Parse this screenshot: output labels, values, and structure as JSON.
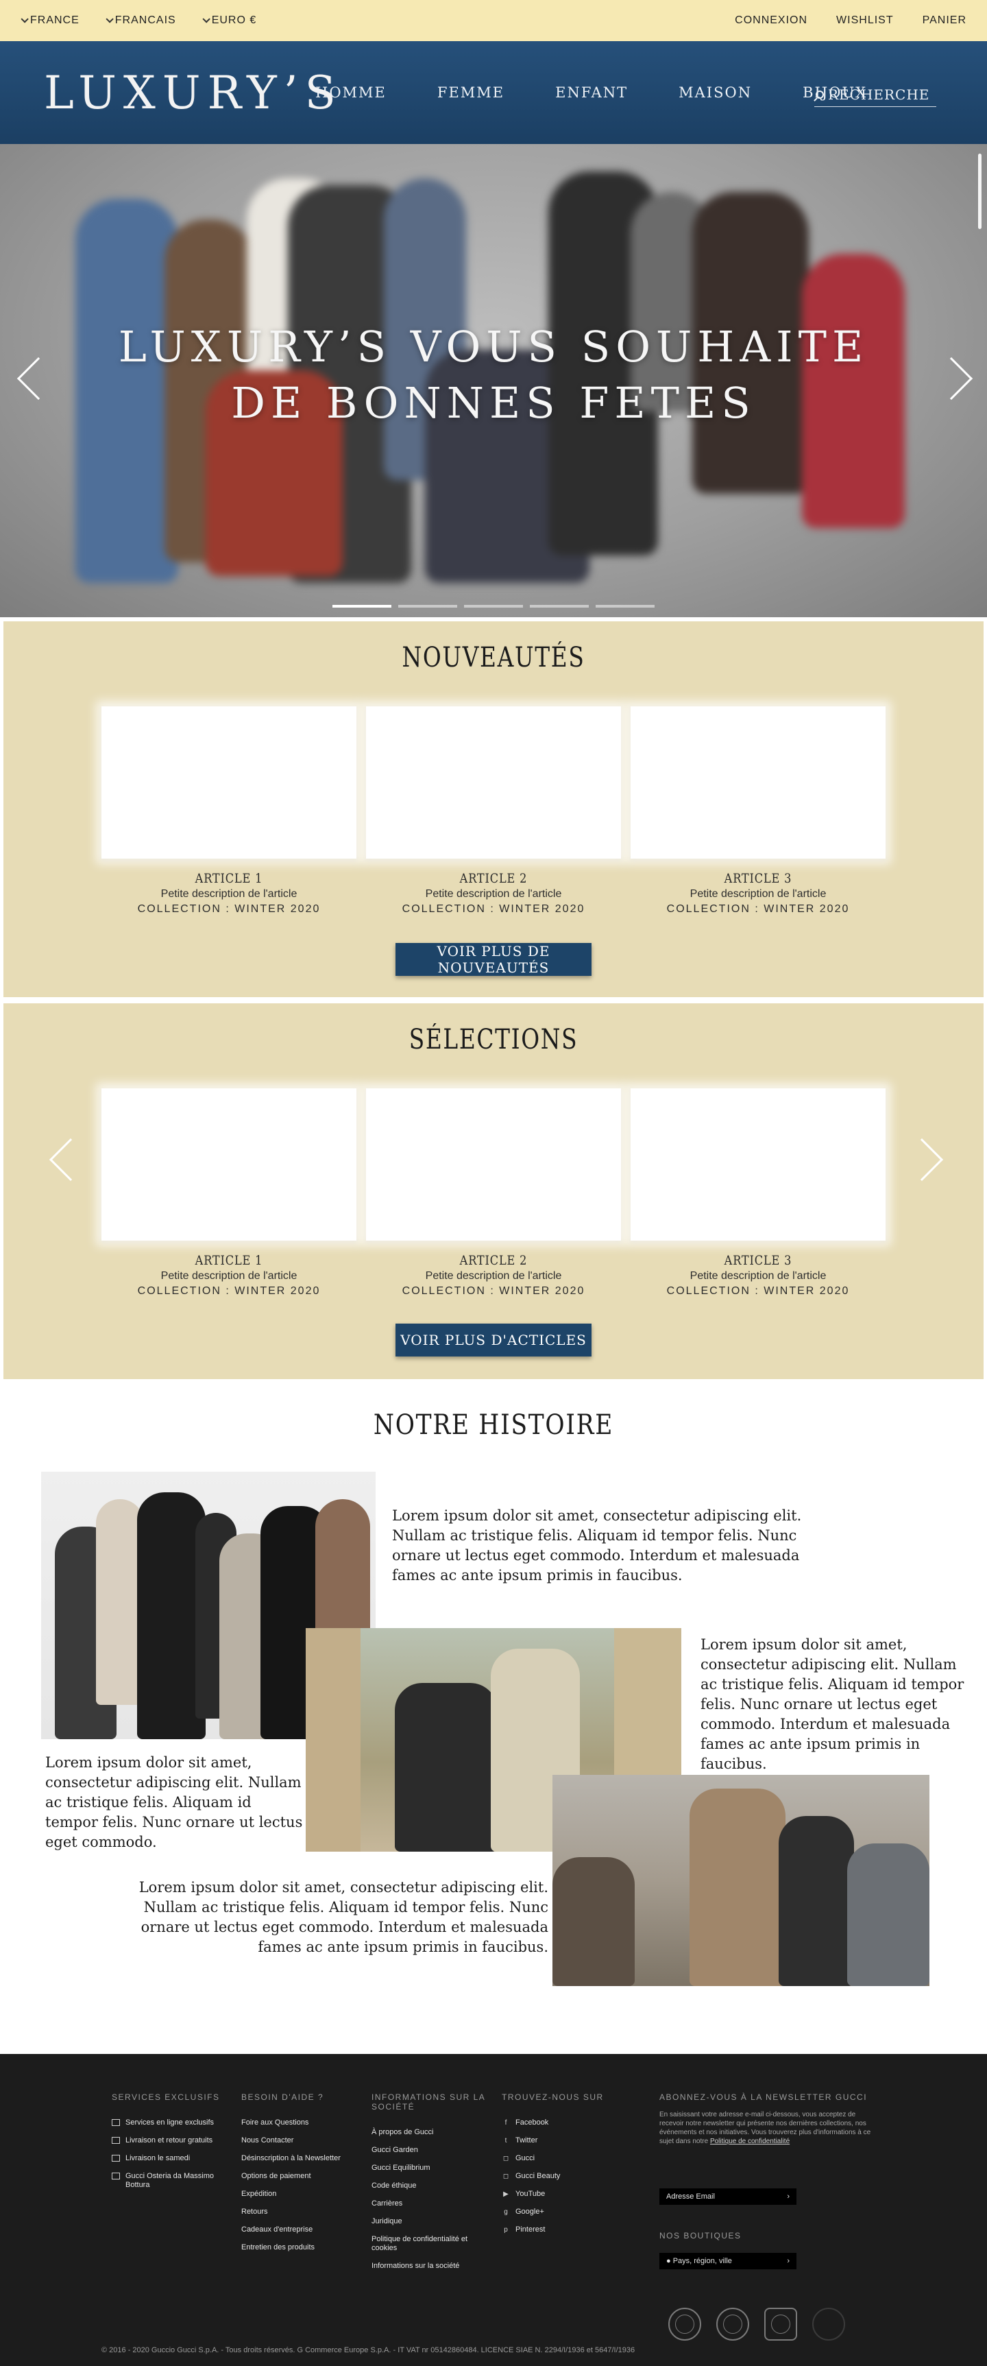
{
  "topbar": {
    "country": "FRANCE",
    "language": "FRANCAIS",
    "currency": "EURO €",
    "links": [
      "CONNEXION",
      "WISHLIST",
      "PANIER"
    ]
  },
  "header": {
    "logo": "LUXURY’S",
    "nav": [
      "HOMME",
      "FEMME",
      "ENFANT",
      "MAISON",
      "BIJOUX"
    ],
    "search_label": "RECHERCHE"
  },
  "hero": {
    "title_line1": "LUXURY’S VOUS SOUHAITE",
    "title_line2": "DE BONNES FETES",
    "slides": 5,
    "active_slide": 1
  },
  "nouveautes": {
    "title": "NOUVEAUTÉS",
    "items": [
      {
        "name": "ARTICLE 1",
        "desc": "Petite description de l'article",
        "collection": "COLLECTION : WINTER 2020"
      },
      {
        "name": "ARTICLE 2",
        "desc": "Petite description de l'article",
        "collection": "COLLECTION : WINTER 2020"
      },
      {
        "name": "ARTICLE 3",
        "desc": "Petite description de l'article",
        "collection": "COLLECTION : WINTER 2020"
      }
    ],
    "button": "VOIR PLUS DE NOUVEAUTÉS"
  },
  "selections": {
    "title": "SÉLECTIONS",
    "items": [
      {
        "name": "ARTICLE 1",
        "desc": "Petite description de l'article",
        "collection": "COLLECTION : WINTER 2020"
      },
      {
        "name": "ARTICLE 2",
        "desc": "Petite description de l'article",
        "collection": "COLLECTION : WINTER 2020"
      },
      {
        "name": "ARTICLE 3",
        "desc": "Petite description de l'article",
        "collection": "COLLECTION : WINTER 2020"
      }
    ],
    "button": "VOIR PLUS D'ACTICLES"
  },
  "story": {
    "title": "NOTRE HISTOIRE",
    "text1": "Lorem ipsum dolor sit amet, consectetur adipiscing elit. Nullam ac tristique felis. Aliquam id tempor felis. Nunc ornare ut lectus eget commodo. Interdum et malesuada fames ac ante ipsum primis in faucibus.",
    "text2": "Lorem ipsum dolor sit amet, consectetur adipiscing elit. Nullam ac tristique felis. Aliquam id tempor felis. Nunc ornare ut lectus eget commodo. Interdum et malesuada fames ac ante ipsum primis in faucibus.",
    "text3": "Lorem ipsum dolor sit amet, consectetur adipiscing elit. Nullam ac tristique felis. Aliquam id tempor felis. Nunc ornare ut lectus eget commodo.",
    "text4": "Lorem ipsum dolor sit amet, consectetur adipiscing elit. Nullam ac tristique felis. Aliquam id tempor felis. Nunc ornare ut lectus eget commodo. Interdum et malesuada fames ac ante ipsum primis in faucibus."
  },
  "footer": {
    "services": {
      "title": "SERVICES EXCLUSIFS",
      "items": [
        "Services en ligne exclusifs",
        "Livraison et retour gratuits",
        "Livraison le samedi",
        "Gucci Osteria da Massimo Bottura"
      ]
    },
    "help": {
      "title": "BESOIN D'AIDE ?",
      "items": [
        "Foire aux Questions",
        "Nous Contacter",
        "Désinscription à la Newsletter",
        "Options de paiement",
        "Expédition",
        "Retours",
        "Cadeaux d'entreprise",
        "Entretien des produits"
      ]
    },
    "company": {
      "title": "INFORMATIONS SUR LA SOCIÉTÉ",
      "items": [
        "À propos de Gucci",
        "Gucci Garden",
        "Gucci Equilibrium",
        "Code éthique",
        "Carrières",
        "Juridique",
        "Politique de confidentialité et cookies",
        "Informations sur la société"
      ]
    },
    "social": {
      "title": "TROUVEZ-NOUS SUR",
      "items": [
        "Facebook",
        "Twitter",
        "Gucci",
        "Gucci Beauty",
        "YouTube",
        "Google+",
        "Pinterest"
      ]
    },
    "newsletter": {
      "title": "ABONNEZ-VOUS À LA NEWSLETTER GUCCI",
      "text": "En saisissant votre adresse e-mail ci-dessous, vous acceptez de recevoir notre newsletter qui présente nos dernières collections, nos événements et nos initiatives. Vous trouverez plus d'informations à ce sujet dans notre",
      "policy_link": "Politique de confidentialité",
      "email_placeholder": "Adresse Email",
      "boutiques_title": "NOS BOUTIQUES",
      "location_placeholder": "Pays, région, ville"
    },
    "copyright": "© 2016 - 2020 Guccio Gucci S.p.A. - Tous droits réservés. G Commerce Europe S.p.A. - IT VAT nr 05142860484. LICENCE SIAE N. 2294/I/1936 et 5647/I/1936"
  }
}
